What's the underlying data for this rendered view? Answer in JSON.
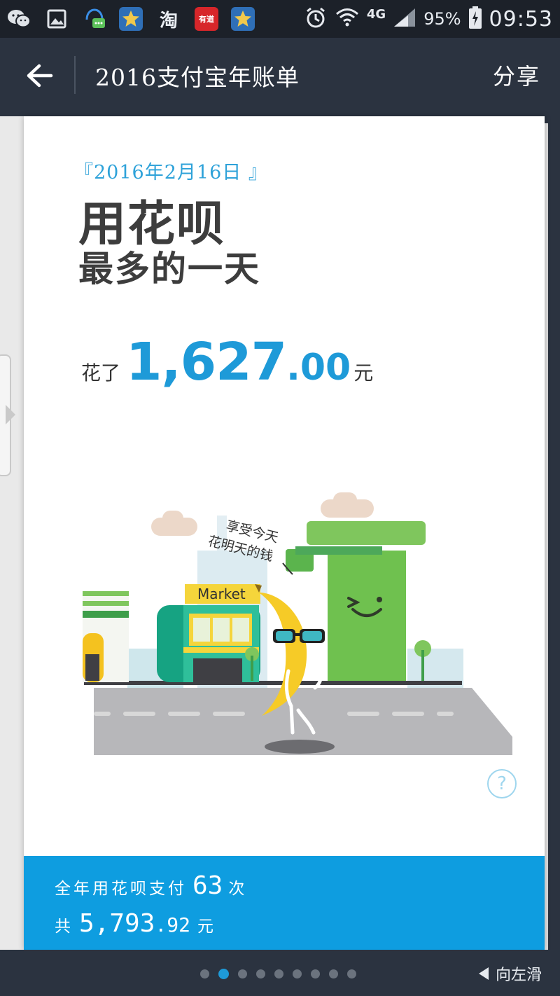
{
  "status_bar": {
    "battery": "95%",
    "time": "09:53",
    "network": "4G",
    "icons": [
      "wechat-icon",
      "gallery-icon",
      "qq-icon",
      "star-app-icon",
      "taobao-icon",
      "youdao-icon",
      "star-app-icon",
      "alarm-icon",
      "wifi-icon",
      "signal-icon",
      "battery-icon"
    ],
    "app_labels": {
      "taobao": "淘",
      "youdao": "有道"
    }
  },
  "header": {
    "title": "2016支付宝年账单",
    "share": "分享"
  },
  "card": {
    "date": "『2016年2月16日 』",
    "headline_line1": "用花呗",
    "headline_line2": "最多的一天",
    "amount_prefix": "花了",
    "amount_int": "1,627",
    "amount_dec": ".00",
    "amount_unit": "元",
    "illustration": {
      "speech_line1": "享受今天",
      "speech_line2": "花明天的钱",
      "market_sign": "Market"
    },
    "help": "?"
  },
  "summary": {
    "line1_prefix": "全年用花呗支付",
    "count": "63",
    "line1_suffix": "次",
    "line2_prefix": "共",
    "total_int": "5,793",
    "total_dec": ".92",
    "line2_suffix": "元"
  },
  "pager": {
    "total_pages": 9,
    "current_page": 2,
    "swipe_hint": "向左滑"
  },
  "colors": {
    "accent": "#1e9ad8",
    "summary_bg": "#0e9de0",
    "header_bg": "#2b3340",
    "status_bg": "#1c2129",
    "headline": "#3d3d3d"
  }
}
